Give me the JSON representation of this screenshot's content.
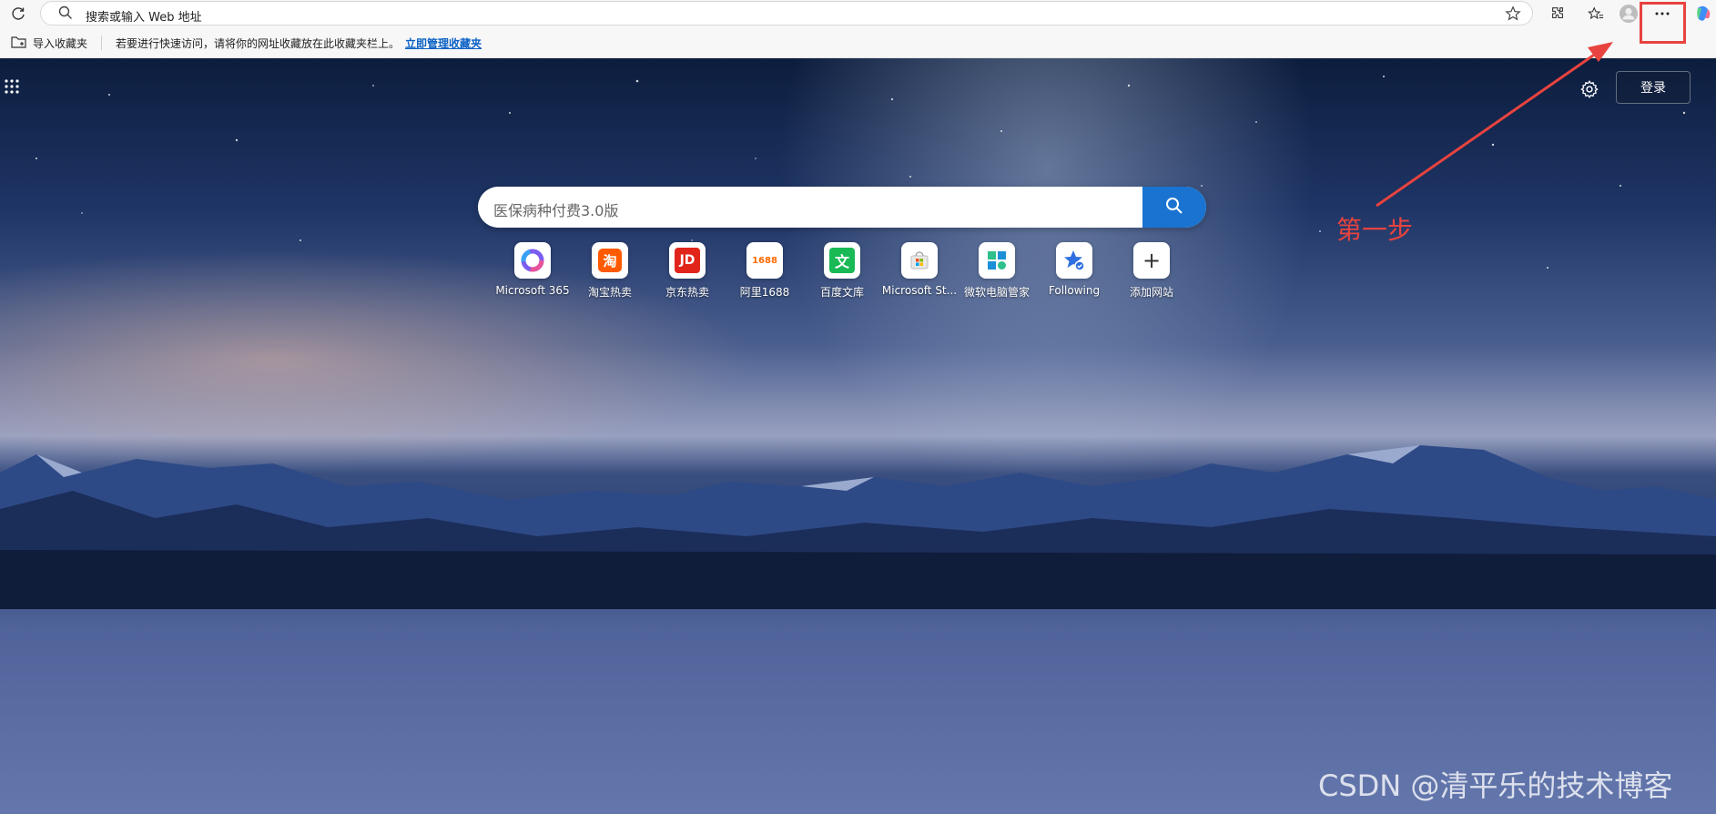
{
  "address_bar": {
    "placeholder": "搜索或输入 Web 地址"
  },
  "bookmarks_bar": {
    "import_label": "导入收藏夹",
    "hint": "若要进行快速访问，请将你的网址收藏放在此收藏夹栏上。",
    "manage_link": "立即管理收藏夹"
  },
  "header": {
    "login_label": "登录"
  },
  "search": {
    "query": "医保病种付费3.0版"
  },
  "quick_links": [
    {
      "label": "Microsoft 365"
    },
    {
      "label": "淘宝热卖",
      "badge": "淘"
    },
    {
      "label": "京东热卖",
      "badge": "JD"
    },
    {
      "label": "阿里1688",
      "badge": "1688"
    },
    {
      "label": "百度文库",
      "badge": "文"
    },
    {
      "label": "Microsoft St..."
    },
    {
      "label": "微软电脑管家"
    },
    {
      "label": "Following"
    },
    {
      "label": "添加网站",
      "badge": "+"
    }
  ],
  "annotation": {
    "step_label": "第一步"
  },
  "watermark": "CSDN @清平乐的技术博客",
  "colors": {
    "accent": "#1a73d0",
    "annotation_red": "#e8433f"
  }
}
